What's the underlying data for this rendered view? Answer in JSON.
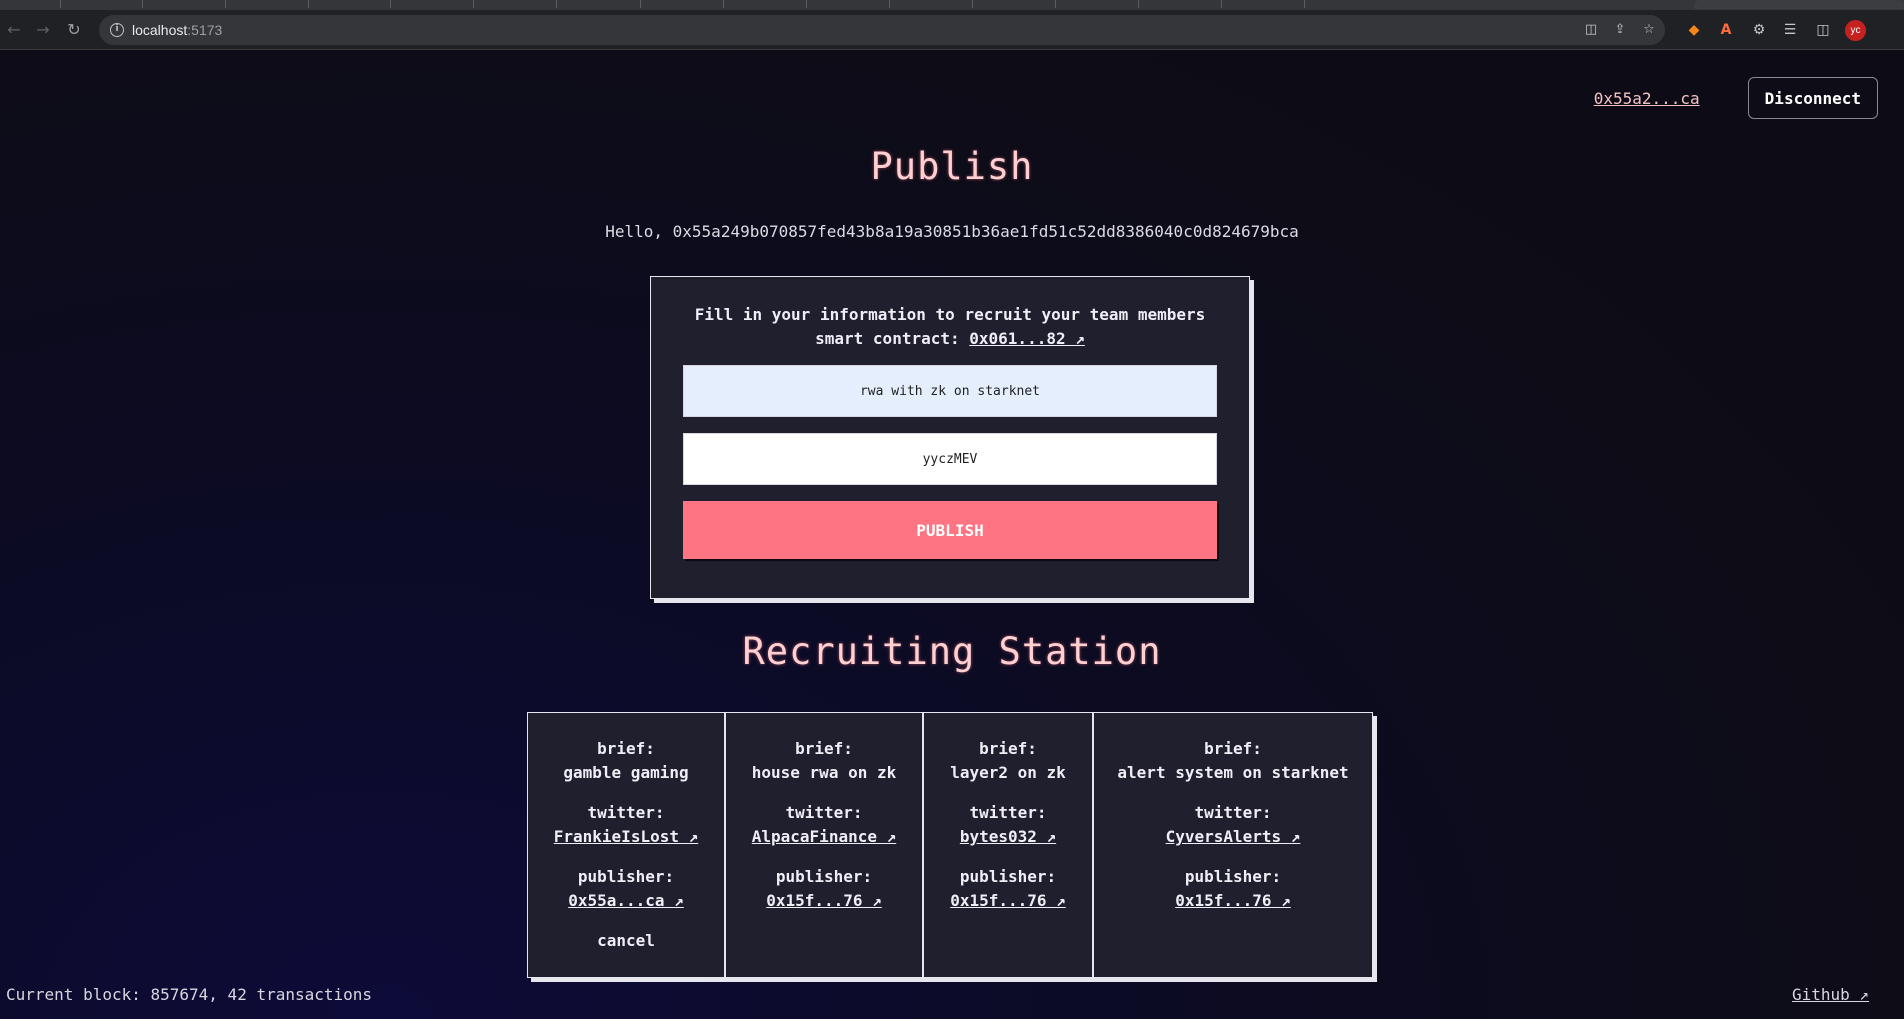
{
  "browser": {
    "url_host": "localhost",
    "url_port": ":5173",
    "profile_initials": "yc"
  },
  "header": {
    "account_short": "0x55a2...ca",
    "disconnect_label": "Disconnect"
  },
  "publish": {
    "title": "Publish",
    "greeting": "Hello, 0x55a249b070857fed43b8a19a30851b36ae1fd51c52dd8386040c0d824679bca",
    "form_title": "Fill in your information to recruit your team members",
    "contract_label": "smart contract:",
    "contract_link": "0x061...82 ↗",
    "brief_value": "rwa with zk on starknet",
    "twitter_value": "yyczMEV",
    "button_label": "PUBLISH"
  },
  "station": {
    "title": "Recruiting Station",
    "brief_label": "brief:",
    "twitter_label": "twitter:",
    "publisher_label": "publisher:",
    "cancel_label": "cancel",
    "items": [
      {
        "brief": "gamble gaming",
        "twitter": "FrankieIsLost ↗",
        "publisher": "0x55a...ca ↗"
      },
      {
        "brief": "house rwa on zk",
        "twitter": "AlpacaFinance ↗",
        "publisher": "0x15f...76 ↗"
      },
      {
        "brief": "layer2 on zk",
        "twitter": "bytes032 ↗",
        "publisher": "0x15f...76 ↗"
      },
      {
        "brief": "alert system on starknet",
        "twitter": "CyversAlerts ↗",
        "publisher": "0x15f...76 ↗"
      }
    ]
  },
  "footer": {
    "block_info": "Current block: 857674, 42 transactions",
    "github_link": "Github ↗"
  },
  "colors": {
    "accent": "#ff7482",
    "heading": "#ffd0d2",
    "card_bg": "#201f2e"
  },
  "icons": [
    "back-arrow-icon",
    "forward-arrow-icon",
    "reload-icon",
    "info-icon",
    "translate-icon",
    "share-icon",
    "star-icon",
    "metamask-icon",
    "extension-a-icon",
    "puzzle-icon",
    "media-icon",
    "sidepanel-icon"
  ]
}
